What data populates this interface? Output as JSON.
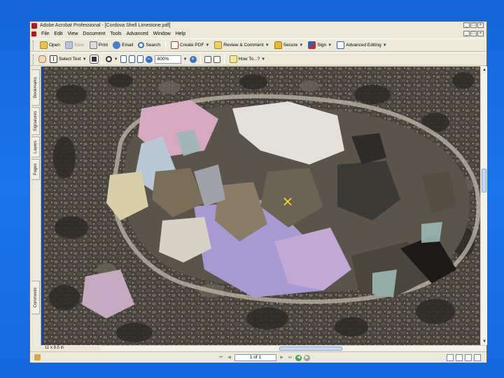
{
  "window": {
    "title": "Adobe Acrobat Professional - [Cordova Shell Limestone.pdf]",
    "controls": {
      "minimize": "_",
      "maximize": "□",
      "close": "×"
    }
  },
  "menu": {
    "items": [
      "File",
      "Edit",
      "View",
      "Document",
      "Tools",
      "Advanced",
      "Window",
      "Help"
    ]
  },
  "toolbar1": {
    "open": "Open",
    "save": "Save",
    "print": "Print",
    "email": "Email",
    "search": "Search",
    "create_pdf": "Create PDF",
    "review": "Review & Comment",
    "secure": "Secure",
    "sign": "Sign",
    "advanced_editing": "Advanced Editing"
  },
  "toolbar2": {
    "select_text": "Select Text",
    "zoom_value": "800%",
    "how_to": "How To...?"
  },
  "nav_tabs": [
    "Bookmarks",
    "Signatures",
    "Layers",
    "Pages",
    "Comments"
  ],
  "statusbar": {
    "page_size": "11 x 8.5 in",
    "page_display": "1 of 1"
  },
  "document": {
    "image_description": "thin-section micrograph of shell limestone under crossed polars"
  },
  "colors": {
    "desktop_bg": "#1a6fe8",
    "chrome_bg": "#ece9d8",
    "nav_strip": "#1a44a0"
  }
}
